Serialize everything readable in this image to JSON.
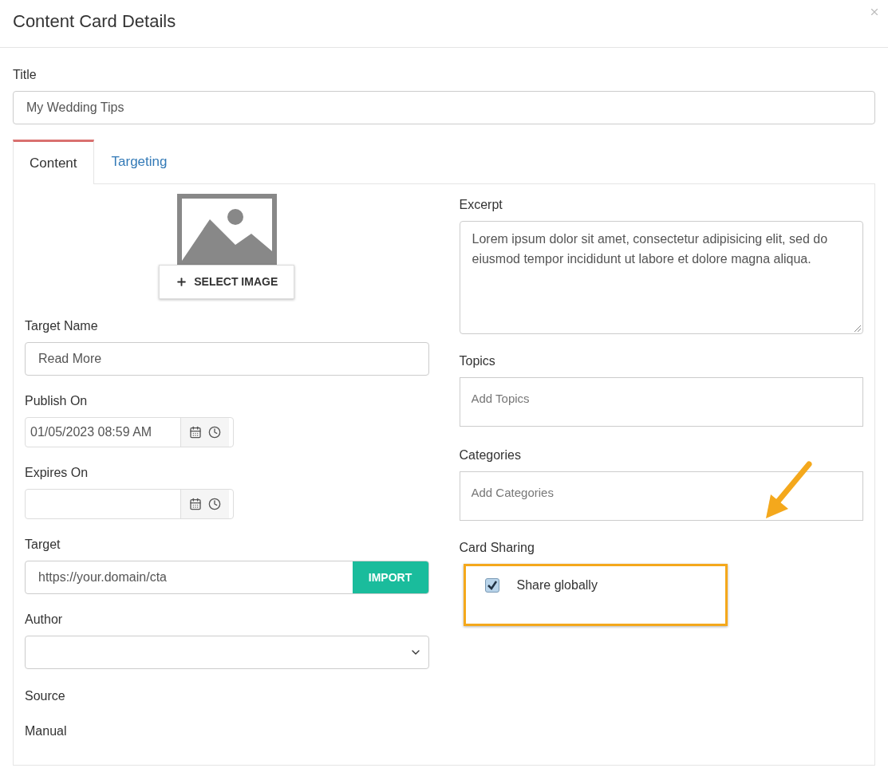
{
  "dialog": {
    "title": "Content Card Details"
  },
  "title_field": {
    "label": "Title",
    "value": "My Wedding Tips"
  },
  "tabs": [
    {
      "label": "Content",
      "selected": true
    },
    {
      "label": "Targeting",
      "selected": false
    }
  ],
  "image": {
    "button": "SELECT IMAGE"
  },
  "target_name": {
    "label": "Target Name",
    "value": "Read More"
  },
  "publish_on": {
    "label": "Publish On",
    "value": "01/05/2023 08:59 AM"
  },
  "expires_on": {
    "label": "Expires On"
  },
  "target": {
    "label": "Target",
    "value": "https://your.domain/cta",
    "button": "IMPORT"
  },
  "author": {
    "label": "Author"
  },
  "source": {
    "label": "Source",
    "value": "Manual"
  },
  "excerpt": {
    "label": "Excerpt",
    "value": "Lorem ipsum dolor sit amet, consectetur adipisicing elit, sed do eiusmod tempor incididunt ut labore et dolore magna aliqua."
  },
  "topics": {
    "label": "Topics",
    "placeholder": "Add Topics"
  },
  "categories": {
    "label": "Categories",
    "placeholder": "Add Categories"
  },
  "card_sharing": {
    "label": "Card Sharing",
    "option": "Share globally",
    "checked": true
  }
}
